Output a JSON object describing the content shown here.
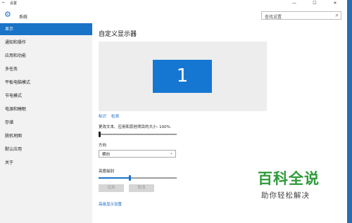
{
  "window": {
    "title": "设置",
    "back_icon": "←",
    "minimize": "—",
    "maximize": "☐",
    "close": "✕"
  },
  "header": {
    "app_title": "系统",
    "gear_icon": "⚙",
    "search_placeholder": "查找设置",
    "search_icon": "⌕"
  },
  "sidebar": {
    "items": [
      {
        "label": "显示",
        "active": true
      },
      {
        "label": "通知和操作"
      },
      {
        "label": "应用和功能"
      },
      {
        "label": "多任务"
      },
      {
        "label": "平板电脑模式"
      },
      {
        "label": "节电模式"
      },
      {
        "label": "电源和睡眠"
      },
      {
        "label": "存储"
      },
      {
        "label": "脱机地图"
      },
      {
        "label": "默认应用"
      },
      {
        "label": "关于"
      }
    ]
  },
  "main": {
    "title": "自定义显示器",
    "monitor_number": "1",
    "identify_link": "标识",
    "detect_link": "检测",
    "scale_label": "更改文本、应用和其他项目的大小: 100%",
    "scale_value": 100,
    "orientation_label": "方向",
    "orientation_value": "横向",
    "orientation_chevron": "⌄",
    "brightness_label": "亮度级别",
    "brightness_value": 0.4,
    "apply_button": "应用",
    "cancel_button": "取消",
    "advanced_link": "高级显示设置"
  },
  "watermark": {
    "title": "百科全说",
    "subtitle": "助你轻松解决"
  },
  "colors": {
    "accent": "#1a73c7",
    "sidebar_bg": "#f2f2f2",
    "watermark_green": "#2e9b3a"
  }
}
